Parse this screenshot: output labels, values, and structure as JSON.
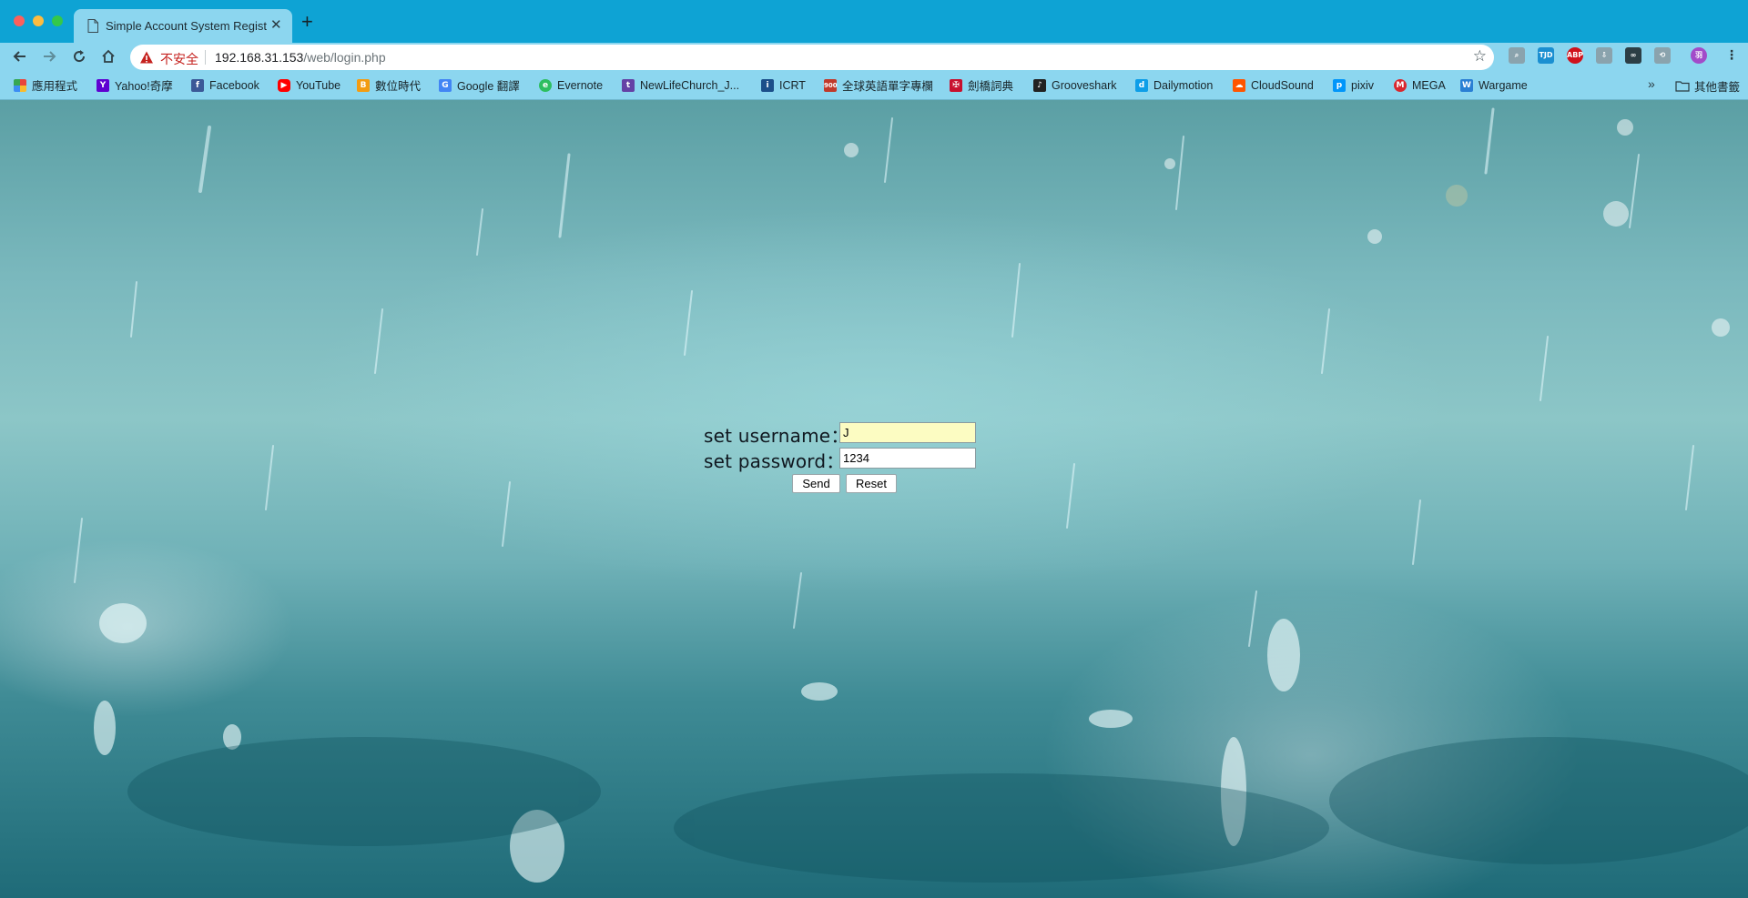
{
  "browser": {
    "tab": {
      "title": "Simple Account System Regist..."
    },
    "address": {
      "security_label": "不安全",
      "host": "192.168.31.153",
      "path": "/web/login.php"
    },
    "bookmarks": [
      {
        "label": "應用程式",
        "icon": "apps-grid-icon",
        "color": "#e8453c"
      },
      {
        "label": "Yahoo!奇摩",
        "icon": "yahoo-icon",
        "color": "#5f01d1"
      },
      {
        "label": "Facebook",
        "icon": "facebook-icon",
        "color": "#3b5998"
      },
      {
        "label": "YouTube",
        "icon": "youtube-icon",
        "color": "#ff0000"
      },
      {
        "label": "數位時代",
        "icon": "bnext-icon",
        "color": "#f39c12"
      },
      {
        "label": "Google 翻譯",
        "icon": "google-translate-icon",
        "color": "#4285f4"
      },
      {
        "label": "Evernote",
        "icon": "evernote-icon",
        "color": "#2dbe60"
      },
      {
        "label": "NewLifeChurch_J...",
        "icon": "twitch-icon",
        "color": "#6441a5"
      },
      {
        "label": "ICRT",
        "icon": "icrt-icon",
        "color": "#1b4f8a"
      },
      {
        "label": "全球英語單字專欄",
        "icon": "900-icon",
        "color": "#c0392b"
      },
      {
        "label": "劍橋詞典",
        "icon": "cambridge-icon",
        "color": "#c8102e"
      },
      {
        "label": "Grooveshark",
        "icon": "grooveshark-icon",
        "color": "#222222"
      },
      {
        "label": "Dailymotion",
        "icon": "dailymotion-icon",
        "color": "#0d9ee8"
      },
      {
        "label": "CloudSound",
        "icon": "soundcloud-icon",
        "color": "#ff5500"
      },
      {
        "label": "pixiv",
        "icon": "pixiv-icon",
        "color": "#0096fa"
      },
      {
        "label": "MEGA",
        "icon": "mega-icon",
        "color": "#d9272e"
      },
      {
        "label": "Wargame",
        "icon": "wargame-icon",
        "color": "#2a7fd4"
      }
    ],
    "bookmarks_more": "»",
    "other_bookmarks": "其他書籤"
  },
  "form": {
    "username_label": "set username：",
    "password_label": "set password：",
    "username_value": "J",
    "password_value": "1234",
    "send_label": "Send",
    "reset_label": "Reset"
  }
}
